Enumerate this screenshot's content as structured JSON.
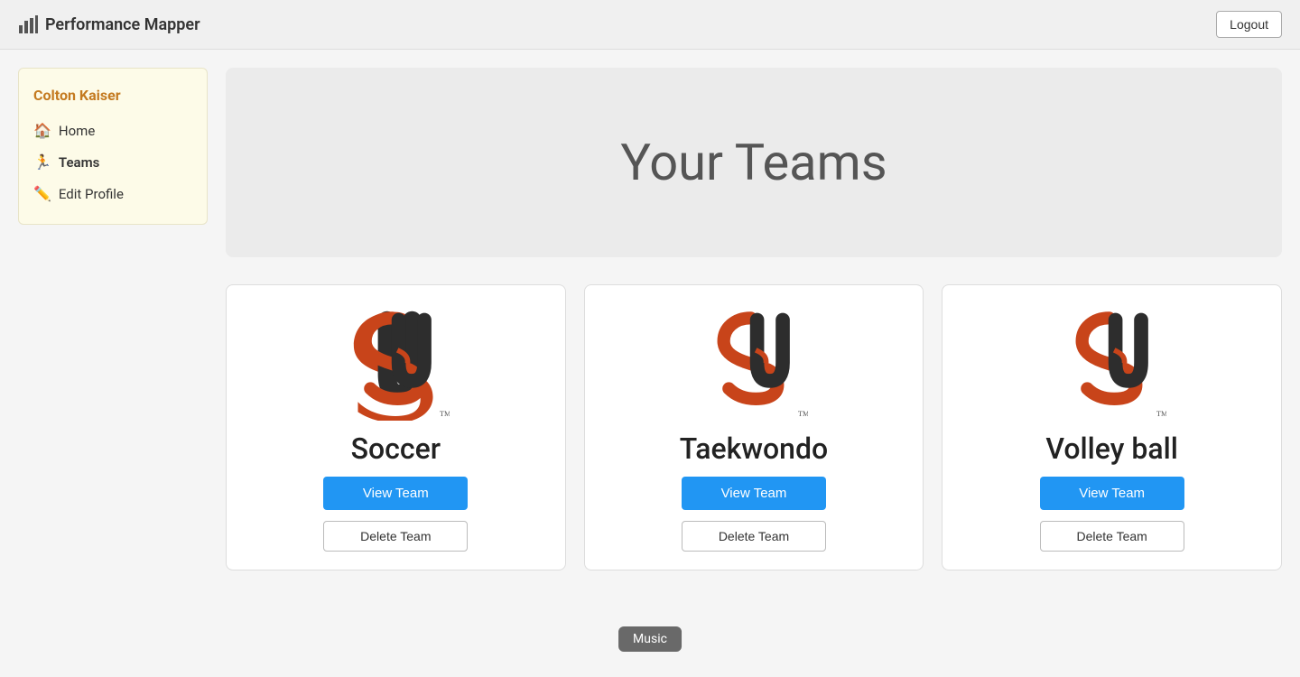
{
  "header": {
    "brand": "Performance Mapper",
    "logout_label": "Logout"
  },
  "sidebar": {
    "username": "Colton Kaiser",
    "items": [
      {
        "id": "home",
        "label": "Home",
        "icon": "🏠"
      },
      {
        "id": "teams",
        "label": "Teams",
        "icon": "🏃",
        "active": true
      },
      {
        "id": "edit-profile",
        "label": "Edit Profile",
        "icon": "✏️"
      }
    ]
  },
  "main": {
    "hero_title": "Your Teams",
    "teams": [
      {
        "id": "soccer",
        "name": "Soccer",
        "view_label": "View Team",
        "delete_label": "Delete Team"
      },
      {
        "id": "taekwondo",
        "name": "Taekwondo",
        "view_label": "View Team",
        "delete_label": "Delete Team"
      },
      {
        "id": "volley-ball",
        "name": "Volley ball",
        "view_label": "View Team",
        "delete_label": "Delete Team"
      }
    ]
  },
  "tooltip": {
    "label": "Music"
  }
}
